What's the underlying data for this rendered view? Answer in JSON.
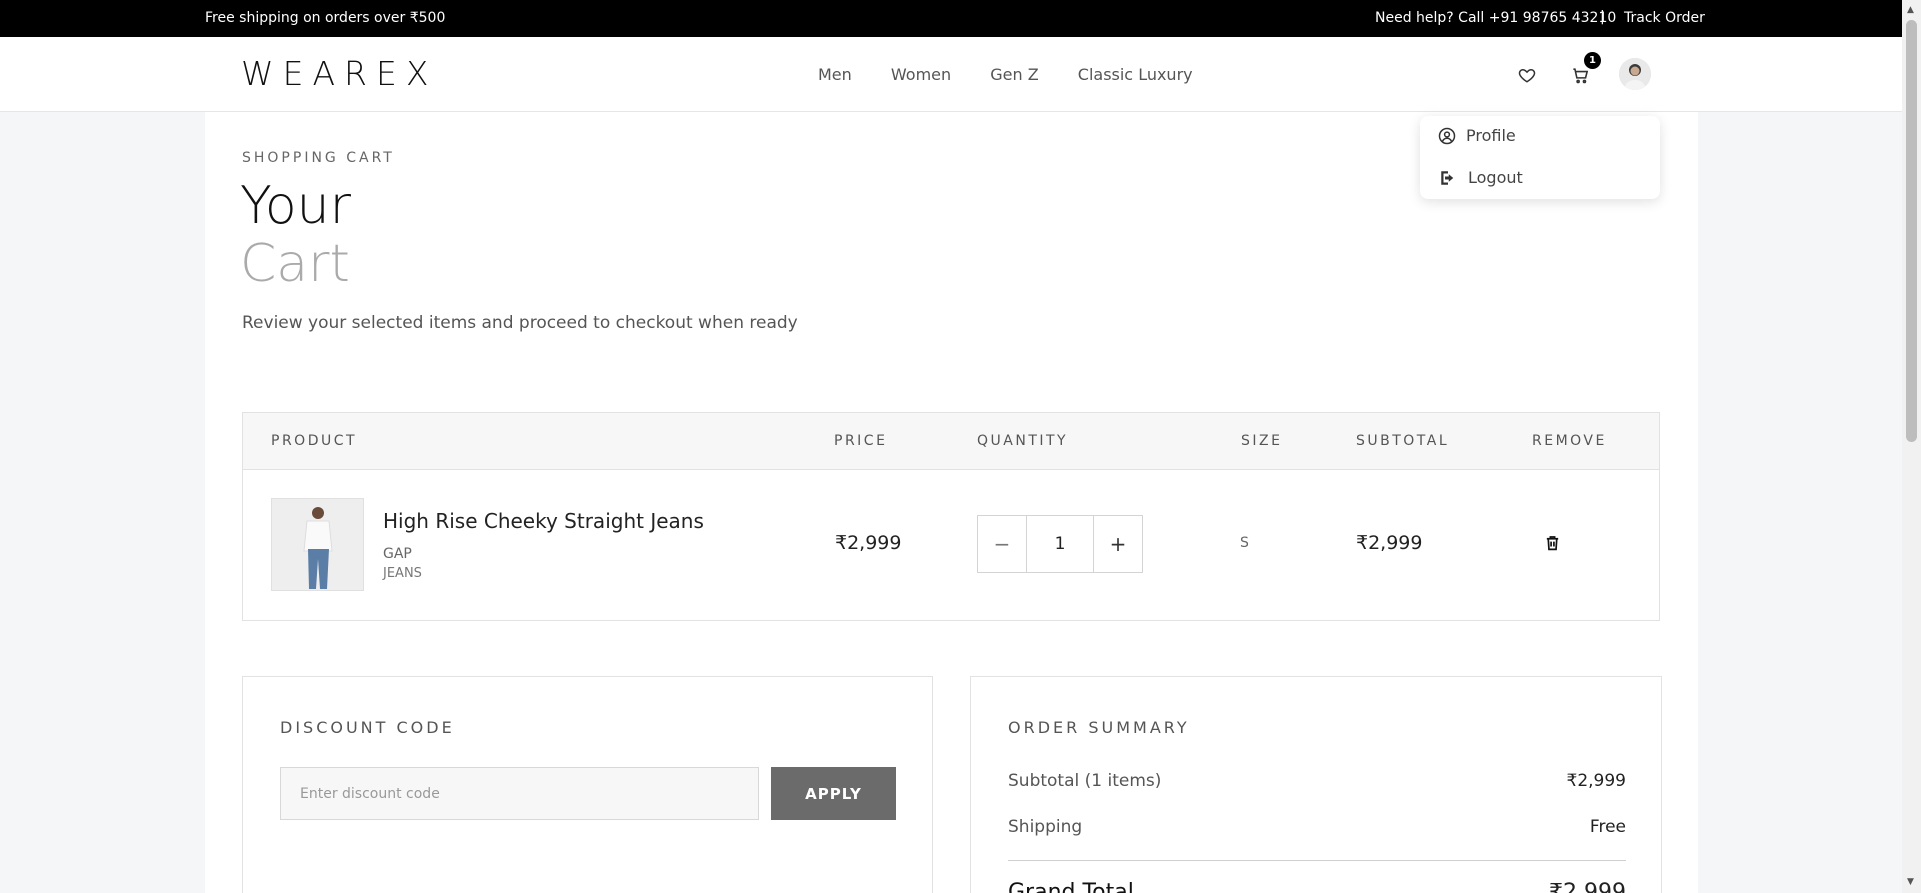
{
  "topbar": {
    "promo": "Free shipping on orders over ₹500",
    "help": "Need help? Call +91 98765 43210",
    "separator": "|",
    "track_order": "Track Order"
  },
  "header": {
    "logo": "WEAREX",
    "nav": [
      "Men",
      "Women",
      "Gen Z",
      "Classic Luxury"
    ],
    "cart_count": "1",
    "icons": [
      "heart-icon",
      "cart-icon",
      "avatar"
    ]
  },
  "user_menu": {
    "items": [
      {
        "label": "Profile",
        "icon": "user-circle-icon"
      },
      {
        "label": "Logout",
        "icon": "logout-icon"
      }
    ]
  },
  "page": {
    "eyebrow": "SHOPPING CART",
    "title_line1": "Your",
    "title_line2": "Cart",
    "subtitle": "Review your selected items and proceed to checkout when ready"
  },
  "cart_table": {
    "headers": [
      "PRODUCT",
      "PRICE",
      "QUANTITY",
      "SIZE",
      "SUBTOTAL",
      "REMOVE"
    ],
    "rows": [
      {
        "name": "High Rise Cheeky Straight Jeans",
        "brand": "GAP",
        "category": "JEANS",
        "price": "₹2,999",
        "quantity": "1",
        "decrement": "−",
        "increment": "+",
        "size": "S",
        "subtotal": "₹2,999"
      }
    ]
  },
  "discount": {
    "title": "DISCOUNT CODE",
    "placeholder": "Enter discount code",
    "apply_label": "APPLY"
  },
  "summary": {
    "title": "ORDER SUMMARY",
    "subtotal_label": "Subtotal (1 items)",
    "subtotal_value": "₹2,999",
    "shipping_label": "Shipping",
    "shipping_value": "Free",
    "grand_total_label": "Grand Total",
    "grand_total_value": "₹2,999"
  },
  "colors": {
    "topbar_bg": "#000000",
    "apply_button": "#6b6b6b",
    "page_bg": "#f5f6f7"
  }
}
